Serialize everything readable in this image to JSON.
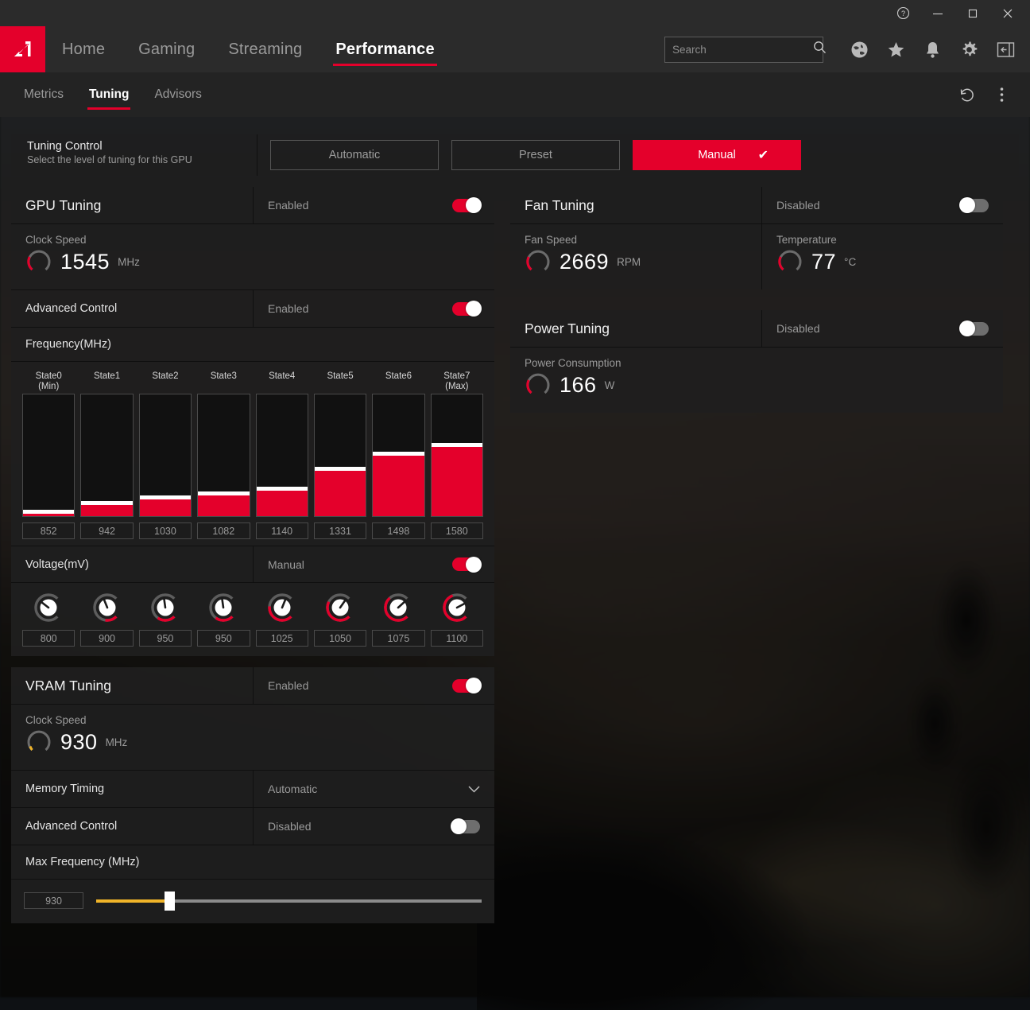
{
  "window": {
    "help_icon": "help-circle-icon",
    "minimize_icon": "minimize-icon",
    "maximize_icon": "maximize-icon",
    "close_icon": "close-icon"
  },
  "nav": {
    "logo": "amd-logo",
    "items": [
      {
        "label": "Home",
        "active": false
      },
      {
        "label": "Gaming",
        "active": false
      },
      {
        "label": "Streaming",
        "active": false
      },
      {
        "label": "Performance",
        "active": true
      }
    ],
    "search": {
      "placeholder": "Search",
      "value": "",
      "icon": "search-icon"
    },
    "icons": [
      "globe-icon",
      "star-icon",
      "bell-icon",
      "gear-icon",
      "collapse-panel-icon"
    ]
  },
  "subnav": {
    "items": [
      {
        "label": "Metrics",
        "active": false
      },
      {
        "label": "Tuning",
        "active": true
      },
      {
        "label": "Advisors",
        "active": false
      }
    ],
    "reset_icon": "undo-reset-icon",
    "overflow_icon": "more-vertical-icon"
  },
  "tuning_control": {
    "title": "Tuning Control",
    "subtitle": "Select the level of tuning for this GPU",
    "options": [
      {
        "label": "Automatic",
        "selected": false
      },
      {
        "label": "Preset",
        "selected": false
      },
      {
        "label": "Manual",
        "selected": true
      }
    ],
    "check_glyph": "✔"
  },
  "gpu_tuning": {
    "title": "GPU Tuning",
    "state_label": "Enabled",
    "enabled": true,
    "clock_speed": {
      "label": "Clock Speed",
      "value": "1545",
      "unit": "MHz"
    },
    "advanced_control": {
      "label": "Advanced Control",
      "state_label": "Enabled",
      "enabled": true
    },
    "frequency": {
      "label": "Frequency(MHz)"
    },
    "voltage": {
      "label": "Voltage(mV)",
      "state_label": "Manual",
      "enabled": true
    }
  },
  "vram_tuning": {
    "title": "VRAM Tuning",
    "state_label": "Enabled",
    "enabled": true,
    "clock_speed": {
      "label": "Clock Speed",
      "value": "930",
      "unit": "MHz"
    },
    "memory_timing": {
      "label": "Memory Timing",
      "value": "Automatic"
    },
    "advanced_control": {
      "label": "Advanced Control",
      "state_label": "Disabled",
      "enabled": false
    },
    "max_frequency": {
      "label": "Max Frequency (MHz)",
      "value": "930",
      "percent": 19
    }
  },
  "fan_tuning": {
    "title": "Fan Tuning",
    "state_label": "Disabled",
    "enabled": false,
    "fan_speed": {
      "label": "Fan Speed",
      "value": "2669",
      "unit": "RPM"
    },
    "temperature": {
      "label": "Temperature",
      "value": "77",
      "unit": "°C"
    }
  },
  "power_tuning": {
    "title": "Power Tuning",
    "state_label": "Disabled",
    "enabled": false,
    "power_consumption": {
      "label": "Power Consumption",
      "value": "166",
      "unit": "W"
    }
  },
  "colors": {
    "accent_red": "#e4002b",
    "accent_yellow": "#f0b429",
    "panel_bg": "#1f1f1f",
    "nav_bg": "#2b2b2b"
  },
  "chart_data": {
    "type": "bar",
    "title": "Frequency(MHz)",
    "xlabel": "",
    "ylabel": "Frequency (MHz)",
    "ylim": [
      0,
      1900
    ],
    "grid": false,
    "legend": "none",
    "categories": [
      "State0\n(Min)",
      "State1",
      "State2",
      "State3",
      "State4",
      "State5",
      "State6",
      "State7\n(Max)"
    ],
    "category_labels": [
      {
        "line1": "State0",
        "line2": "(Min)"
      },
      {
        "line1": "State1",
        "line2": ""
      },
      {
        "line1": "State2",
        "line2": ""
      },
      {
        "line1": "State3",
        "line2": ""
      },
      {
        "line1": "State4",
        "line2": ""
      },
      {
        "line1": "State5",
        "line2": ""
      },
      {
        "line1": "State6",
        "line2": ""
      },
      {
        "line1": "State7",
        "line2": "(Max)"
      }
    ],
    "values": [
      852,
      942,
      1030,
      1082,
      1140,
      1331,
      1498,
      1580
    ],
    "value_labels": [
      "852",
      "942",
      "1030",
      "1082",
      "1140",
      "1331",
      "1498",
      "1580"
    ],
    "fill_percent": [
      2,
      9,
      14,
      17,
      21,
      37,
      50,
      57
    ],
    "voltage_series": {
      "name": "Voltage(mV)",
      "values": [
        800,
        900,
        950,
        950,
        1025,
        1050,
        1075,
        1100
      ],
      "value_labels": [
        "800",
        "900",
        "950",
        "950",
        "1025",
        "1050",
        "1075",
        "1100"
      ],
      "knob_angles": [
        -52,
        -22,
        -8,
        -8,
        22,
        35,
        48,
        62
      ],
      "arc_percent": [
        0,
        20,
        30,
        30,
        52,
        60,
        68,
        76
      ]
    }
  }
}
